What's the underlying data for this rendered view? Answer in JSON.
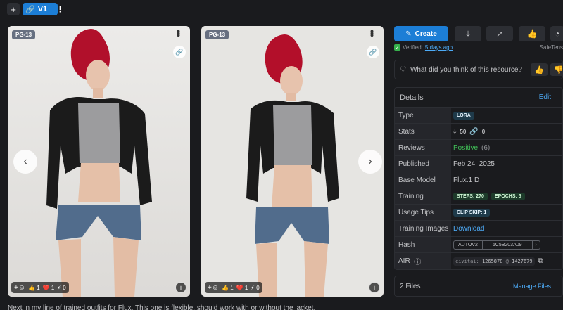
{
  "topbar": {
    "plus": "+",
    "version": "V1"
  },
  "cards": [
    {
      "rating": "PG-13",
      "reactions": {
        "likes": "1",
        "hearts": "1",
        "laughs": "0"
      }
    },
    {
      "rating": "PG-13",
      "reactions": {
        "likes": "1",
        "hearts": "1",
        "laughs": "0"
      }
    }
  ],
  "actions": {
    "create_label": "Create"
  },
  "verified": {
    "label": "Verified:",
    "when": "5 days ago",
    "format": "SafeTens"
  },
  "feedback": {
    "question": "What did you think of this resource?"
  },
  "details": {
    "title": "Details",
    "edit_label": "Edit",
    "type_label": "Type",
    "type_value": "LORA",
    "stats_label": "Stats",
    "stats_downloads": "50",
    "stats_links": "0",
    "reviews_label": "Reviews",
    "reviews_value": "Positive",
    "reviews_count": "(6)",
    "published_label": "Published",
    "published_value": "Feb 24, 2025",
    "base_model_label": "Base Model",
    "base_model_value": "Flux.1 D",
    "training_label": "Training",
    "training_steps": "STEPS: 270",
    "training_epochs": "EPOCHS: 5",
    "usage_label": "Usage Tips",
    "usage_value": "CLIP SKIP: 1",
    "training_images_label": "Training Images",
    "training_images_value": "Download",
    "hash_label": "Hash",
    "hash_type": "AUTOV2",
    "hash_value": "6C5B203A09",
    "air_label": "AIR",
    "air_prefix": "civitai:",
    "air_model": "1265878",
    "air_at": "@",
    "air_version": "1427679"
  },
  "files": {
    "label": "2 Files",
    "manage_label": "Manage Files"
  },
  "description": "Next in my line of trained outfits for Flux. This one is flexible, should work with or without the jacket."
}
